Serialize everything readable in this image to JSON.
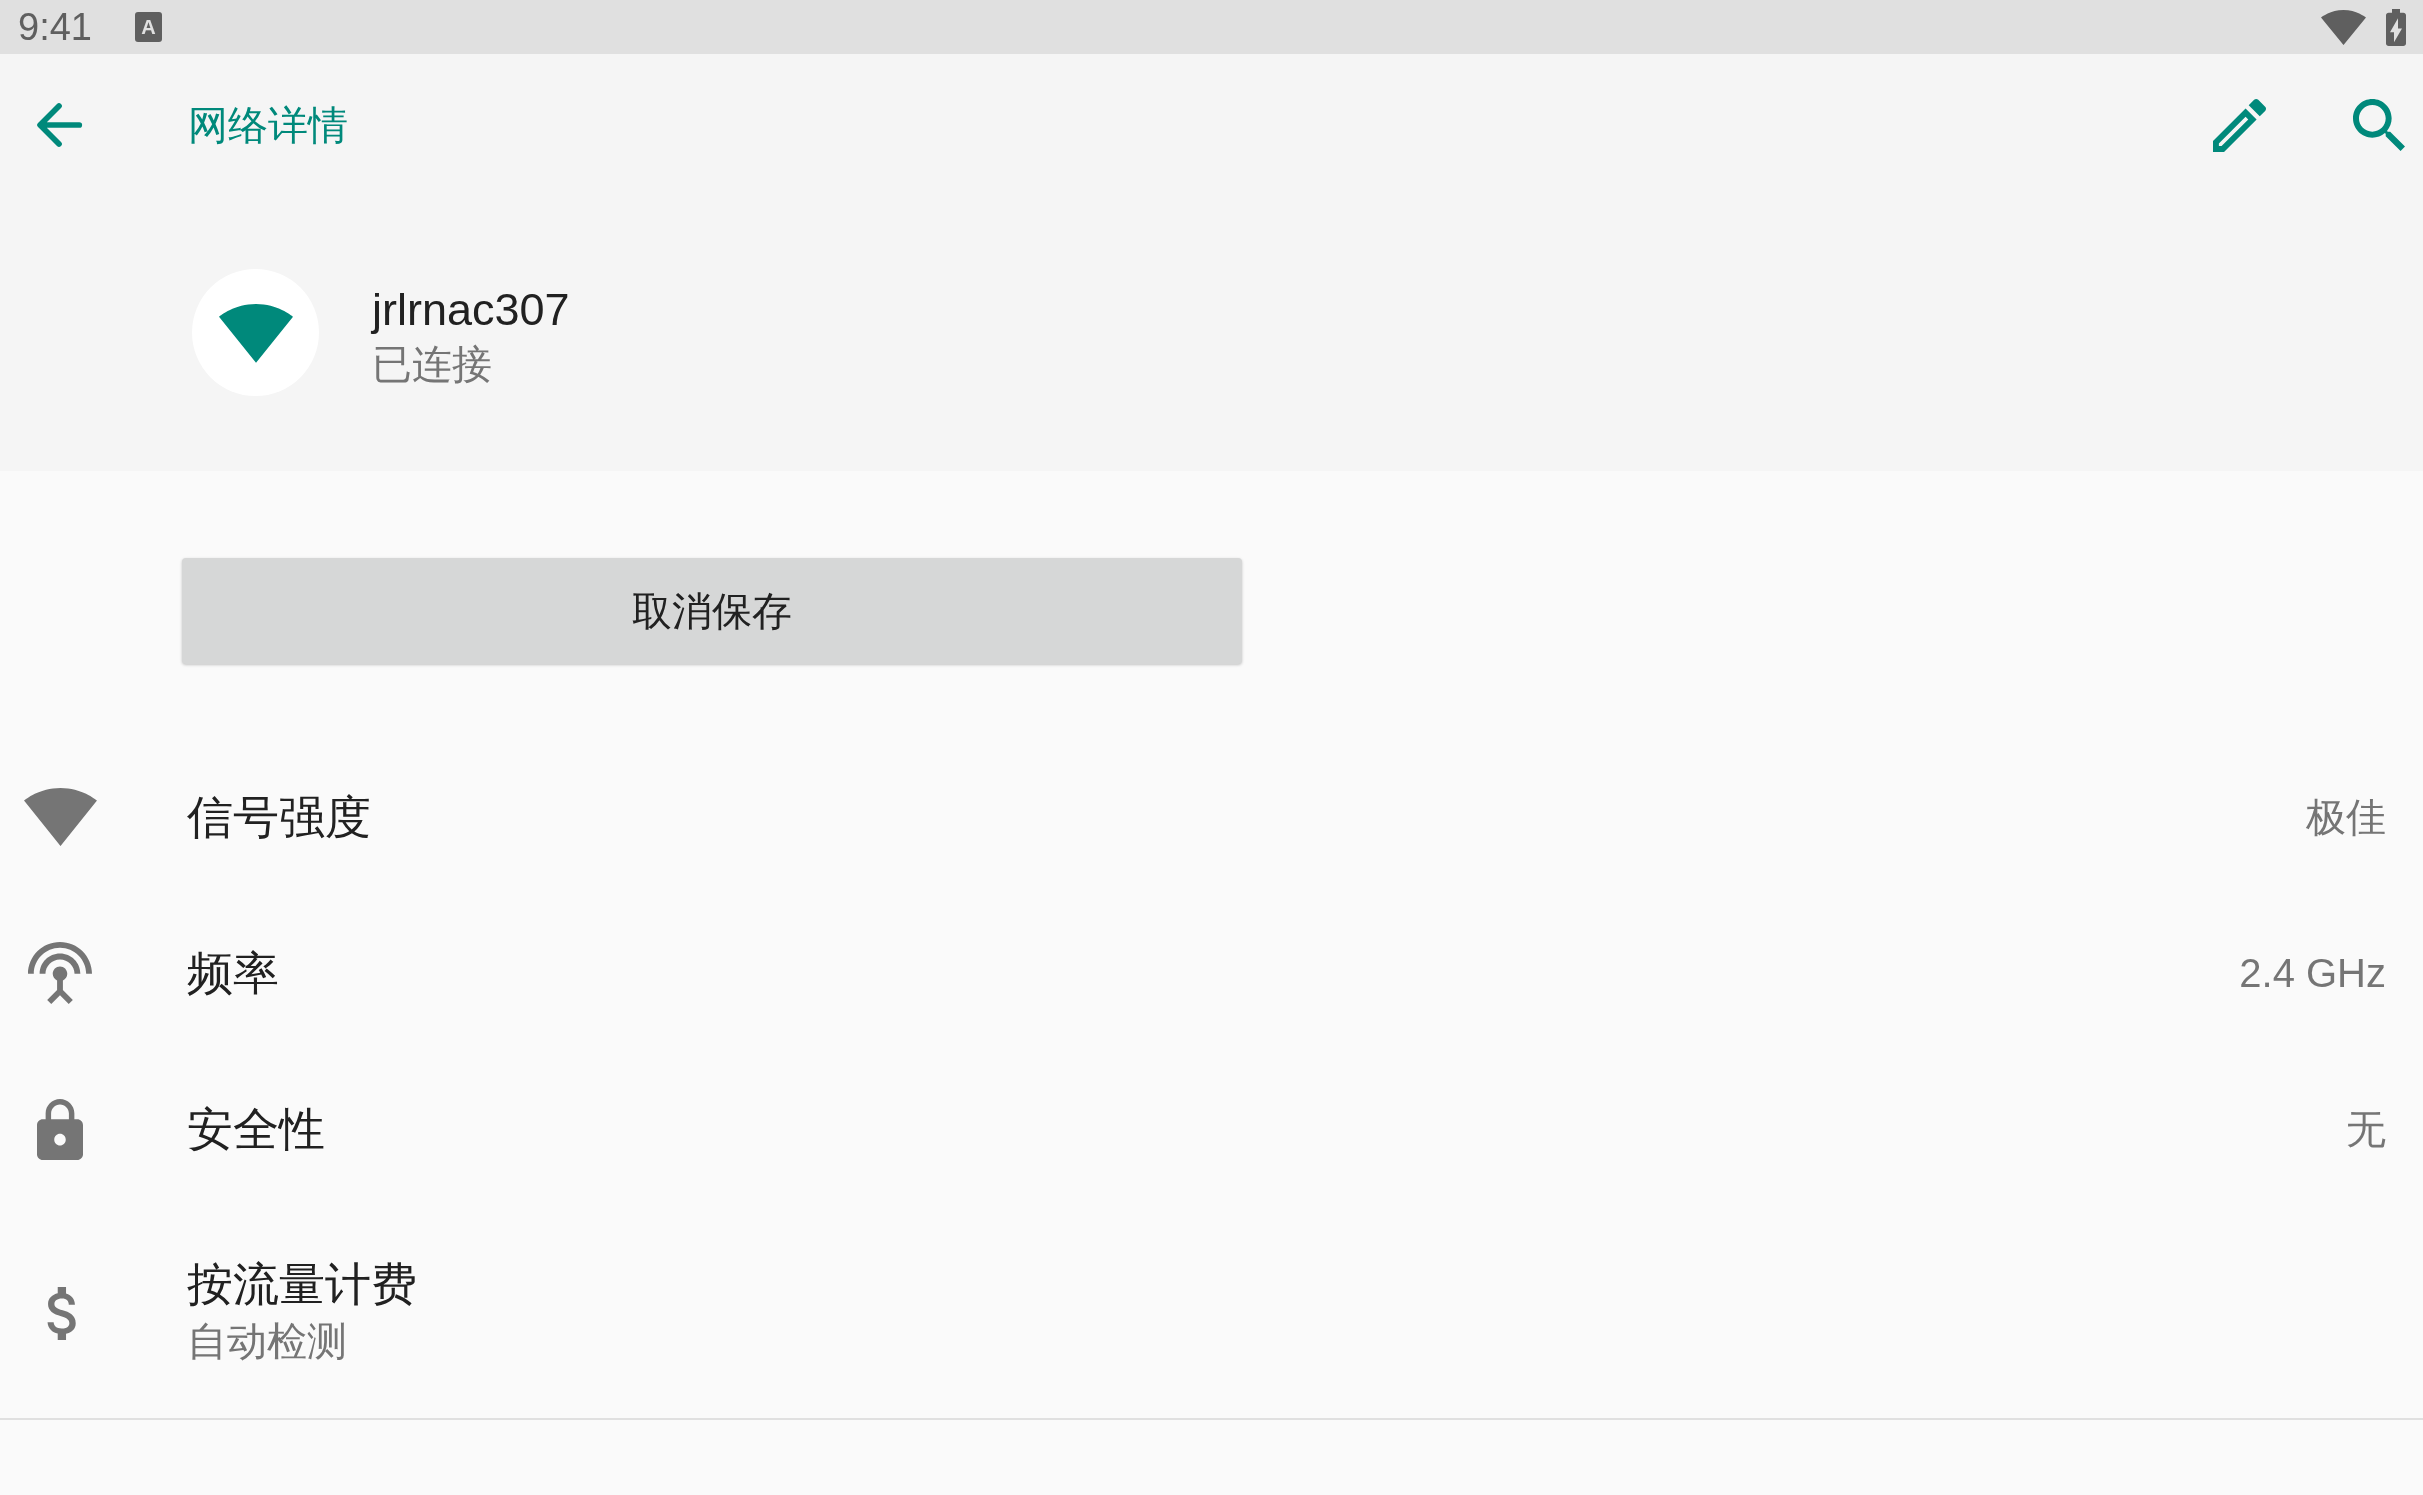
{
  "status_bar": {
    "time": "9:41",
    "notification_glyph": "A"
  },
  "toolbar": {
    "title": "网络详情"
  },
  "network": {
    "name": "jrlrnac307",
    "status": "已连接"
  },
  "forget_button": {
    "label": "取消保存"
  },
  "details": [
    {
      "kind": "signal",
      "label": "信号强度",
      "value": "极佳"
    },
    {
      "kind": "frequency",
      "label": "频率",
      "value": "2.4 GHz"
    },
    {
      "kind": "security",
      "label": "安全性",
      "value": "无"
    },
    {
      "kind": "metered",
      "label": "按流量计费",
      "summary": "自动检测"
    }
  ]
}
